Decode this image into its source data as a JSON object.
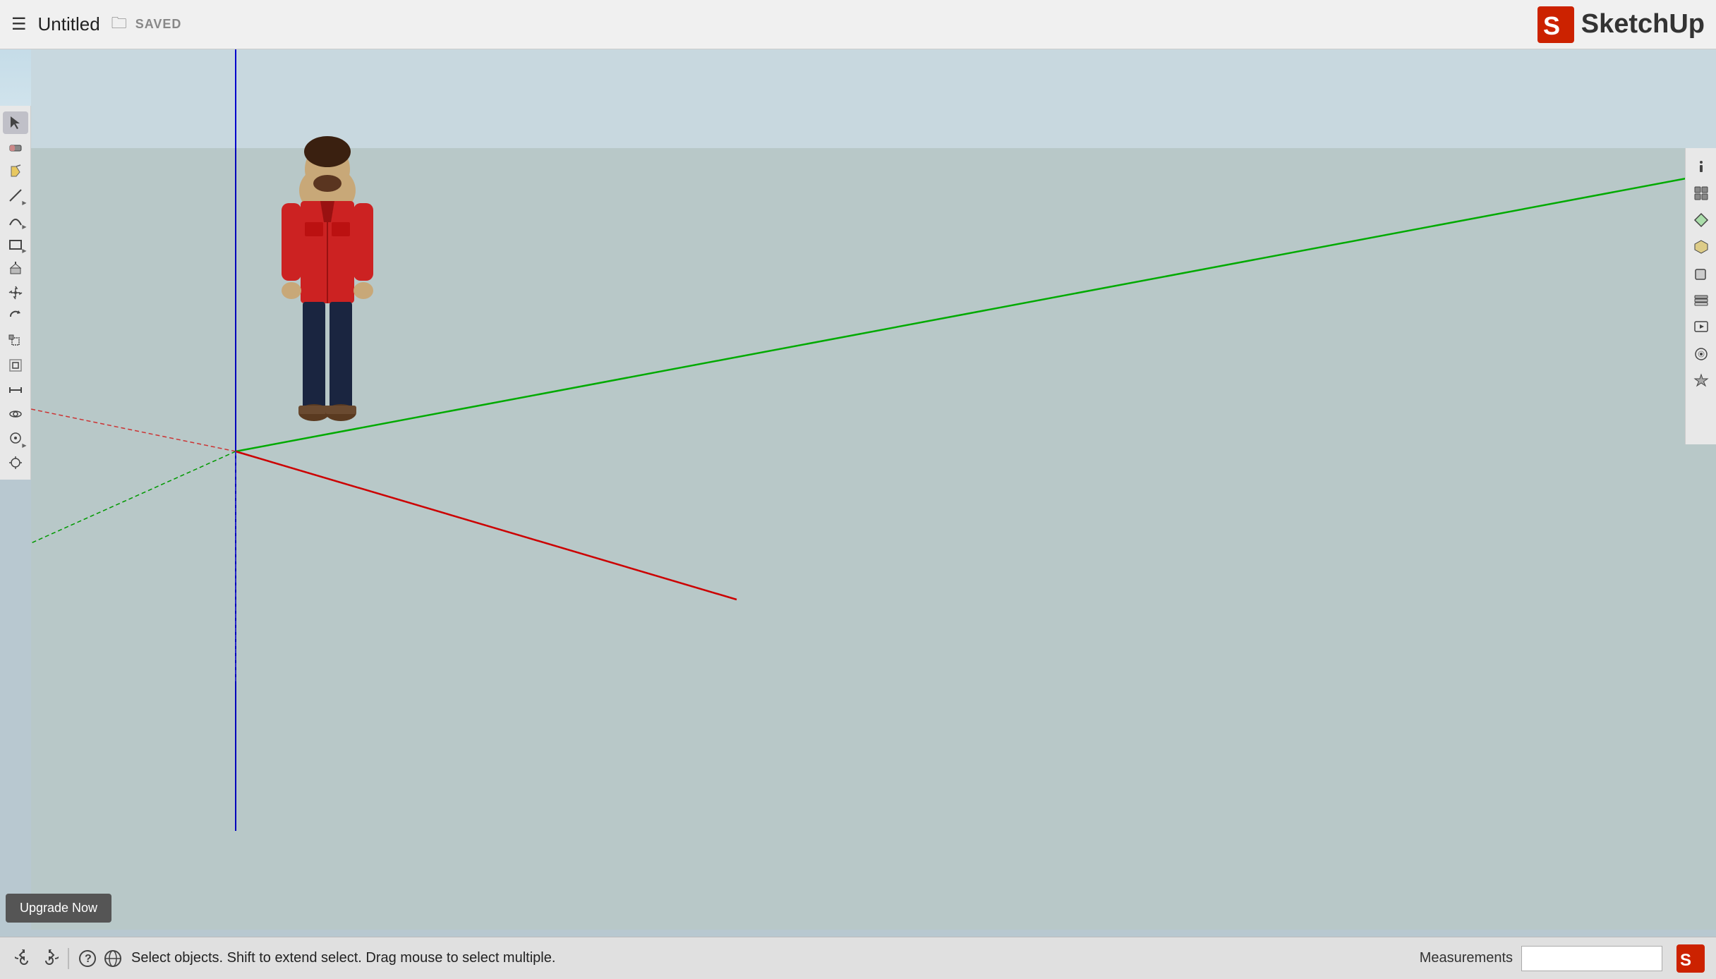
{
  "topbar": {
    "title": "Untitled",
    "saved_label": "SAVED",
    "logo_text": "SketchUp"
  },
  "left_toolbar": {
    "tools": [
      {
        "name": "select",
        "icon": "↖",
        "has_arrow": false
      },
      {
        "name": "eraser",
        "icon": "⬜",
        "has_arrow": false
      },
      {
        "name": "paint-bucket",
        "icon": "◉",
        "has_arrow": false
      },
      {
        "name": "line",
        "icon": "╱",
        "has_arrow": true
      },
      {
        "name": "arc",
        "icon": "⌒",
        "has_arrow": true
      },
      {
        "name": "shapes",
        "icon": "▱",
        "has_arrow": true
      },
      {
        "name": "push-pull",
        "icon": "⬡",
        "has_arrow": false
      },
      {
        "name": "move",
        "icon": "✛",
        "has_arrow": false
      },
      {
        "name": "rotate",
        "icon": "↻",
        "has_arrow": false
      },
      {
        "name": "scale",
        "icon": "⤢",
        "has_arrow": false
      },
      {
        "name": "offset",
        "icon": "⬚",
        "has_arrow": false
      },
      {
        "name": "tape-measure",
        "icon": "✂",
        "has_arrow": false
      },
      {
        "name": "orbit",
        "icon": "⊕",
        "has_arrow": false
      },
      {
        "name": "walk",
        "icon": "◎",
        "has_arrow": true
      },
      {
        "name": "look-around",
        "icon": "◈",
        "has_arrow": false
      }
    ]
  },
  "right_toolbar": {
    "tools": [
      {
        "name": "entity-info",
        "icon": "ℹ"
      },
      {
        "name": "components",
        "icon": "▦"
      },
      {
        "name": "materials",
        "icon": "◧"
      },
      {
        "name": "3d-warehouse",
        "icon": "⬡"
      },
      {
        "name": "solid-tools",
        "icon": "◻"
      },
      {
        "name": "layers",
        "icon": "≡"
      },
      {
        "name": "scenes",
        "icon": "▶"
      },
      {
        "name": "styles",
        "icon": "◎"
      },
      {
        "name": "extension-warehouse",
        "icon": "⚙"
      }
    ]
  },
  "bottombar": {
    "status_text": "Select objects. Shift to extend select. Drag mouse to select multiple.",
    "measurements_label": "Measurements",
    "measurements_value": ""
  },
  "upgrade": {
    "button_label": "Upgrade Now"
  },
  "canvas": {
    "axis_colors": {
      "x_red": "#cc0000",
      "y_green": "#00aa00",
      "z_blue": "#0000cc"
    }
  }
}
